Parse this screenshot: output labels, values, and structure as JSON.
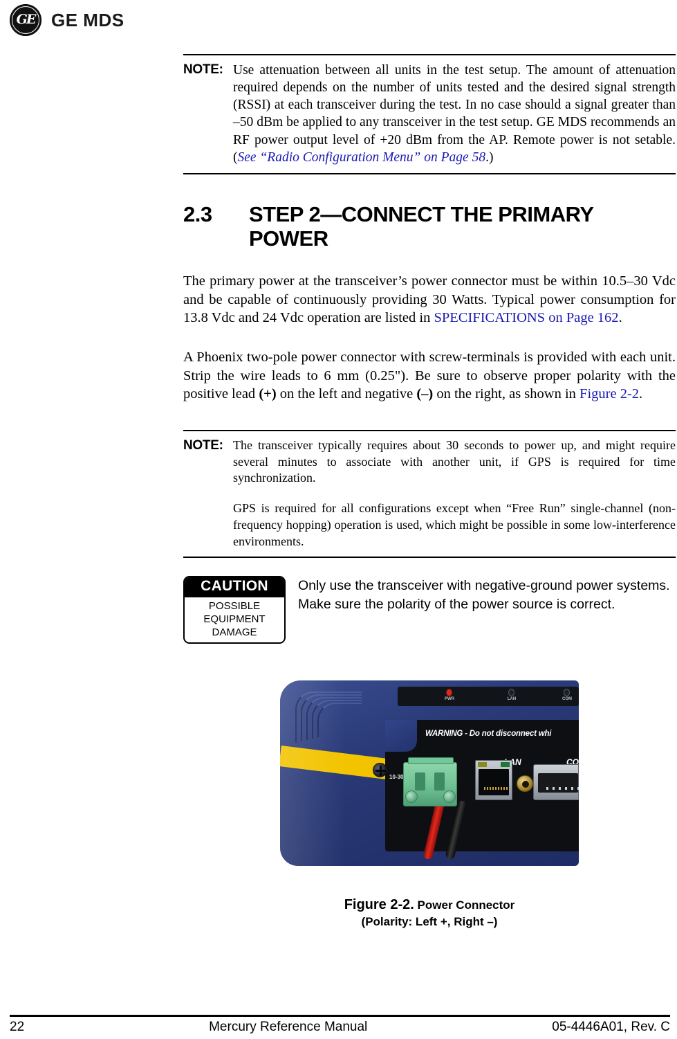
{
  "masthead": {
    "logo_mark": "GE",
    "wordmark": "GE MDS"
  },
  "note_1": {
    "label": "NOTE:",
    "text_part1": "Use attenuation between all units in the test setup. The amount of attenuation required depends on the number of units tested and the desired signal strength (RSSI) at each transceiver during the test. In no case should a signal greater than –50 dBm be applied to any transceiver in the test setup. GE MDS recommends an RF power output level of +20 dBm from the AP. Remote power is not setable. (",
    "link_see": "See ",
    "link_ref": "“Radio Configuration Menu” on Page 58",
    "text_part2": ".)"
  },
  "section": {
    "number": "2.3",
    "title": "STEP 2—CONNECT THE PRIMARY POWER"
  },
  "para_1": {
    "text_before": "The primary power at the transceiver’s power connector must be within 10.5–30 Vdc and be capable of continuously providing 30 Watts. Typical power consumption for 13.8 Vdc and 24 Vdc operation are listed in ",
    "link": "SPECIFICATIONS on Page 162",
    "text_after": "."
  },
  "para_2": {
    "text_a": "A Phoenix two-pole power connector with screw-terminals is provided with each unit. Strip the wire leads to 6 mm (0.25\"). Be sure to observe proper polarity with the positive lead ",
    "plus": "(+)",
    "text_b": " on the left and negative ",
    "minus": "(–)",
    "text_c": " on the right, as shown in ",
    "link": "Figure 2-2",
    "text_d": "."
  },
  "note_2": {
    "label": "NOTE:",
    "paragraph_1": "The transceiver typically requires about 30 seconds to power up, and might require several minutes to associate with another unit, if GPS is required for time synchronization.",
    "paragraph_2": "GPS is required for all configurations except when “Free Run” single-channel (non-frequency hopping) operation is used, which might be possible in some low-interference environments."
  },
  "caution": {
    "heading": "CAUTION",
    "sub_line_1": "POSSIBLE",
    "sub_line_2": "EQUIPMENT",
    "sub_line_3": "DAMAGE",
    "text": "Only use the transceiver with negative-ground power systems. Make sure the polarity of the power source is correct."
  },
  "figure": {
    "caption_number": "Figure 2-2.",
    "caption_title": " Power Connector",
    "caption_subtitle": "(Polarity: Left +, Right –)",
    "photo": {
      "leds": [
        {
          "name": "PWR",
          "state": "on"
        },
        {
          "name": "LAN",
          "state": "off"
        },
        {
          "name": "COM",
          "state": "off"
        }
      ],
      "warning_label": "WARNING - Do not disconnect whi",
      "port_pwr": "PWR",
      "port_lan": "LAN",
      "port_com": "COM",
      "voltage_label": "10-30",
      "wire_positive_color": "#e02a1c",
      "wire_negative_color": "#151515",
      "connector_color": "#6fc193",
      "body_color": "#2a3a78",
      "stripe_color": "#f2c400"
    }
  },
  "footer": {
    "page_number": "22",
    "manual_title": "Mercury Reference Manual",
    "doc_number": "05-4446A01, Rev. C"
  },
  "colors": {
    "link": "#1a19b5",
    "text": "#000000"
  }
}
